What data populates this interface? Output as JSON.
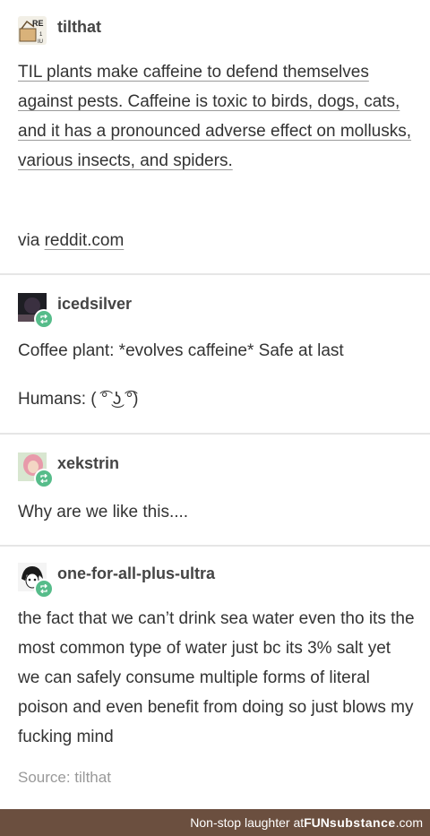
{
  "post1": {
    "username": "tilthat",
    "text": "TIL plants make caffeine to defend themselves against pests. Caffeine is toxic to birds, dogs, cats, and it has a pronounced adverse effect on mollusks, various insects, and spiders.",
    "via_prefix": "via ",
    "via_link": "reddit.com",
    "avatar_icon": "reddit-logo-icon"
  },
  "post2": {
    "username": "icedsilver",
    "line1": "Coffee plant: *evolves caffeine* Safe at last",
    "line2": "Humans: ( ͡° ͜ʖ ͡°)",
    "avatar_icon": "dark-avatar-icon"
  },
  "post3": {
    "username": "xekstrin",
    "text": "Why are we like this....",
    "avatar_icon": "pink-hair-avatar-icon"
  },
  "post4": {
    "username": "one-for-all-plus-ultra",
    "text": "the fact that we can’t drink sea water even tho its the most common type of water just bc its 3% salt yet we can safely consume multiple forms of literal poison and even benefit from doing so just blows my fucking mind",
    "source": "Source: tilthat",
    "avatar_icon": "anime-avatar-icon"
  },
  "footer": {
    "prefix": "Non-stop laughter at ",
    "brand_a": "FUN",
    "brand_b": "substance",
    "brand_c": ".com"
  },
  "colors": {
    "reblog_green": "#56bc8a",
    "footer_bg": "#6b4f3f",
    "divider": "#e6e6e6"
  }
}
